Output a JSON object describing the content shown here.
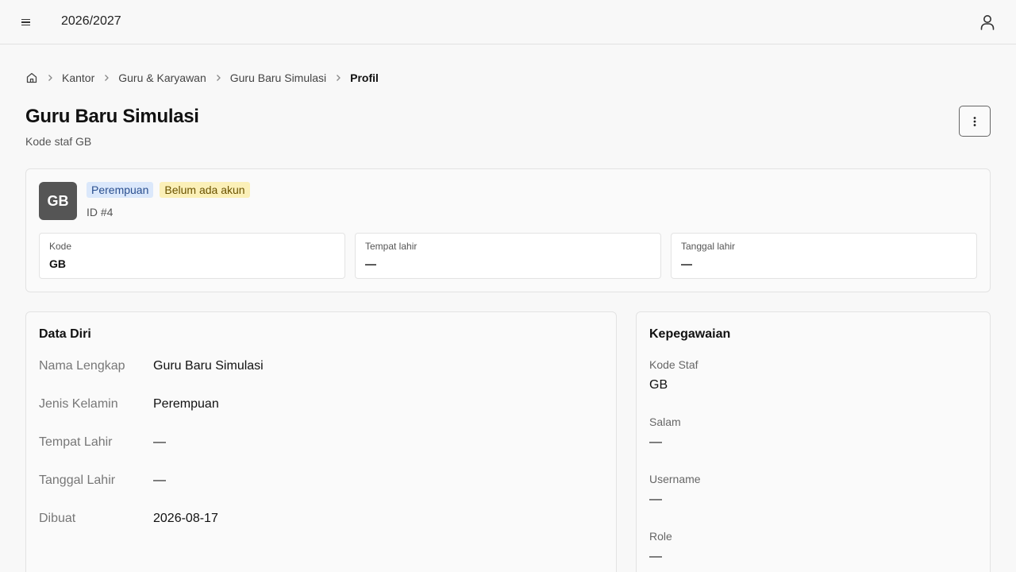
{
  "topbar": {
    "year": "2026/2027",
    "menu_icon": "hamburger-menu-icon",
    "user_icon": "user-icon"
  },
  "breadcrumb": {
    "home_icon": "home-icon",
    "items": [
      "Kantor",
      "Guru & Karyawan",
      "Guru Baru Simulasi",
      "Profil"
    ]
  },
  "header": {
    "title": "Guru Baru Simulasi",
    "subtitle": "Kode staf GB",
    "more_icon": "more-vertical-icon"
  },
  "summary": {
    "initials": "GB",
    "badges": [
      {
        "label": "Perempuan",
        "color": "#dbe8fb"
      },
      {
        "label": "Belum ada akun",
        "color": "#fbf0b8"
      }
    ],
    "id_text": "ID #4",
    "facts": [
      {
        "label": "Kode",
        "value": "GB"
      },
      {
        "label": "Tempat lahir",
        "value": "—"
      },
      {
        "label": "Tanggal lahir",
        "value": "—"
      }
    ]
  },
  "data_diri": {
    "title": "Data Diri",
    "rows": [
      {
        "label": "Nama Lengkap",
        "value": "Guru Baru Simulasi"
      },
      {
        "label": "Jenis Kelamin",
        "value": "Perempuan"
      },
      {
        "label": "Tempat Lahir",
        "value": "—"
      },
      {
        "label": "Tanggal Lahir",
        "value": "—"
      },
      {
        "label": "Dibuat",
        "value": "2026-08-17"
      }
    ]
  },
  "kepegawaian": {
    "title": "Kepegawaian",
    "items": [
      {
        "label": "Kode Staf",
        "value": "GB"
      },
      {
        "label": "Salam",
        "value": "—"
      },
      {
        "label": "Username",
        "value": "—"
      },
      {
        "label": "Role",
        "value": "—"
      }
    ]
  }
}
